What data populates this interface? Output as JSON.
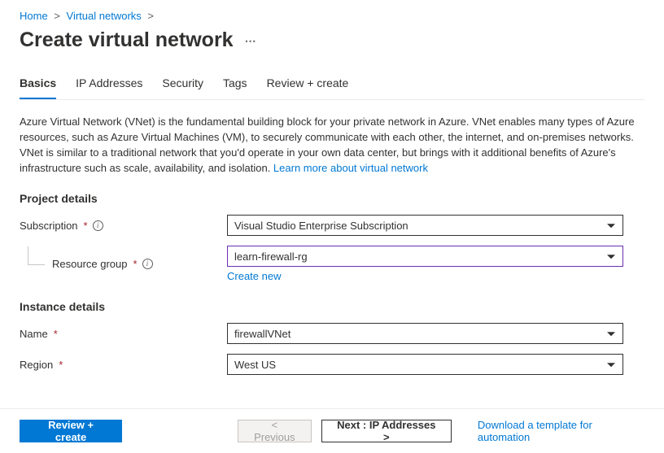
{
  "breadcrumb": {
    "home": "Home",
    "vnets": "Virtual networks"
  },
  "title": "Create virtual network",
  "tabs": {
    "basics": "Basics",
    "ip": "IP Addresses",
    "security": "Security",
    "tags": "Tags",
    "review": "Review + create"
  },
  "intro": {
    "text": "Azure Virtual Network (VNet) is the fundamental building block for your private network in Azure. VNet enables many types of Azure resources, such as Azure Virtual Machines (VM), to securely communicate with each other, the internet, and on-premises networks. VNet is similar to a traditional network that you'd operate in your own data center, but brings with it additional benefits of Azure's infrastructure such as scale, availability, and isolation.  ",
    "learn_more": "Learn more about virtual network"
  },
  "sections": {
    "project": "Project details",
    "instance": "Instance details"
  },
  "labels": {
    "subscription": "Subscription",
    "resource_group": "Resource group",
    "name": "Name",
    "region": "Region"
  },
  "values": {
    "subscription": "Visual Studio Enterprise Subscription",
    "resource_group": "learn-firewall-rg",
    "name": "firewallVNet",
    "region": "West US"
  },
  "links": {
    "create_new": "Create new"
  },
  "footer": {
    "review": "Review + create",
    "previous": "< Previous",
    "next": "Next : IP Addresses >",
    "download": "Download a template for automation"
  }
}
